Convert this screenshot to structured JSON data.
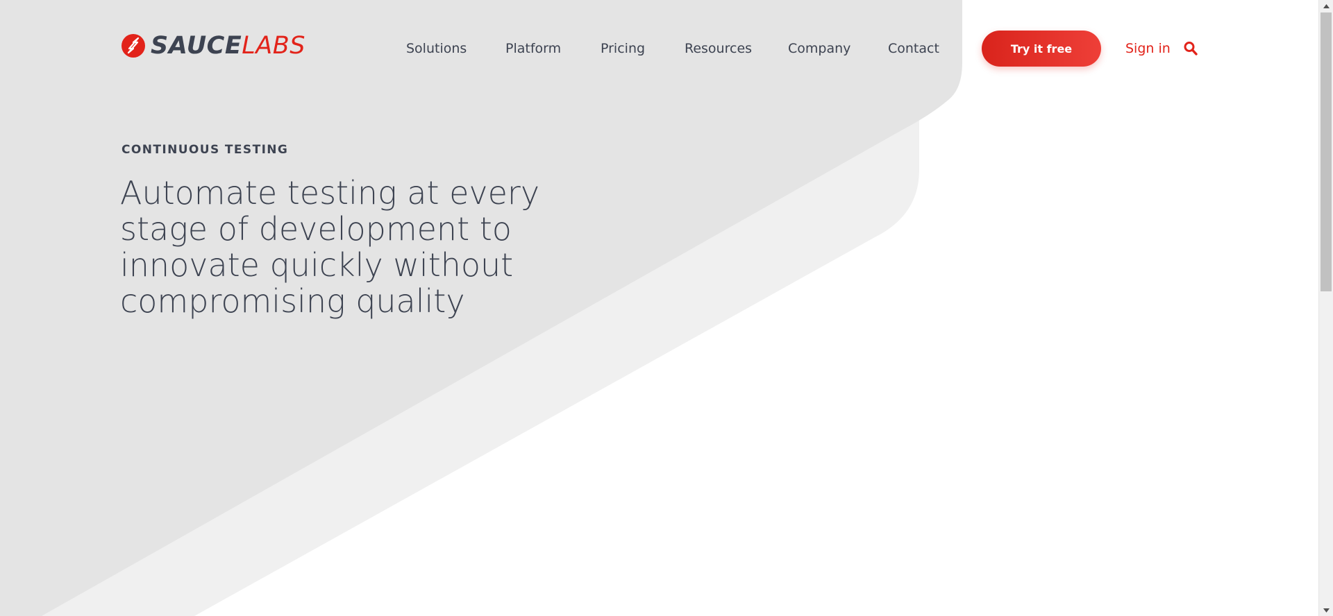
{
  "brand": {
    "logo_part1": "SAUCE",
    "logo_part2": "LABS",
    "primary_color": "#e2231a",
    "text_color": "#3d4351",
    "logo_icon": "lightning-bolt-circle-icon"
  },
  "nav": {
    "items": [
      {
        "label": "Solutions"
      },
      {
        "label": "Platform"
      },
      {
        "label": "Pricing"
      },
      {
        "label": "Resources"
      },
      {
        "label": "Company"
      },
      {
        "label": "Contact"
      }
    ]
  },
  "header": {
    "cta_label": "Try it free",
    "signin_label": "Sign in",
    "search_icon": "search-icon"
  },
  "hero": {
    "eyebrow": "CONTINUOUS TESTING",
    "headline_lines": [
      "Automate testing at every",
      "stage of development to",
      "innovate quickly without",
      "compromising quality"
    ]
  },
  "colors": {
    "bg_dark": "#e4e4e4",
    "bg_light": "#f0f0f0",
    "page_bg": "#ffffff"
  }
}
